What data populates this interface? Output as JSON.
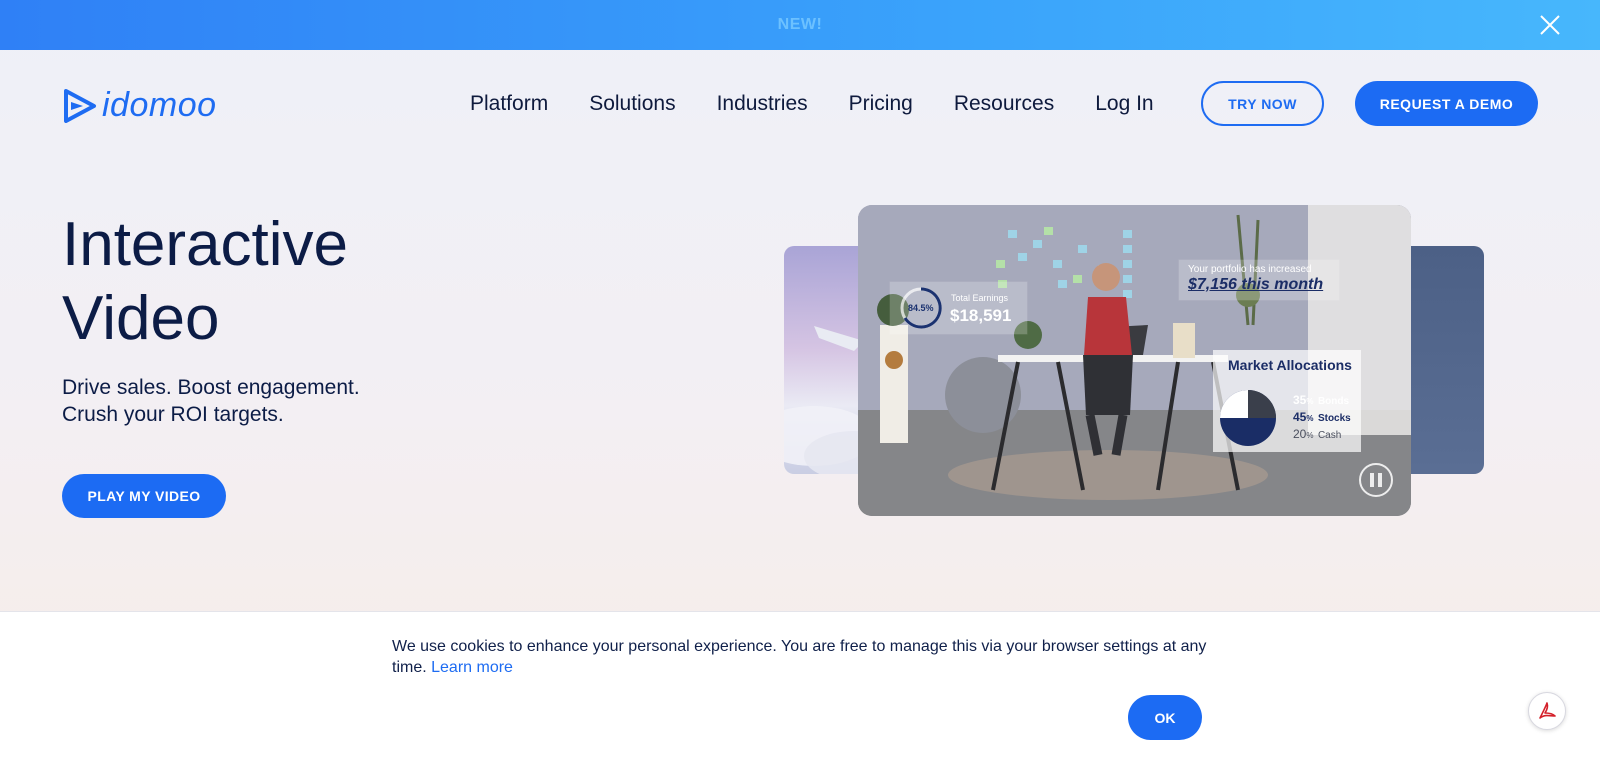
{
  "banner": {
    "text": "NEW!"
  },
  "logo": {
    "text": "idomoo"
  },
  "nav": {
    "items": [
      "Platform",
      "Solutions",
      "Industries",
      "Pricing",
      "Resources",
      "Log In"
    ],
    "try_label": "TRY NOW",
    "demo_label": "REQUEST A DEMO"
  },
  "hero": {
    "title_line1": "Interactive",
    "title_line2": "Video",
    "sub_line1": "Drive sales. Boost engagement.",
    "sub_line2": "Crush your ROI targets.",
    "play_label": "PLAY MY VIDEO"
  },
  "video": {
    "earnings_ring": "84.5%",
    "earnings_label": "Total Earnings",
    "earnings_value": "$18,591",
    "portfolio_label": "Your portfolio has increased",
    "portfolio_value": "$7,156 this month",
    "alloc_title": "Market Allocations",
    "alloc": [
      {
        "pct": "35",
        "unit": "%",
        "label": "Bonds"
      },
      {
        "pct": "45",
        "unit": "%",
        "label": "Stocks"
      },
      {
        "pct": "20",
        "unit": "%",
        "label": "Cash"
      }
    ]
  },
  "cookie": {
    "text": "We use cookies to enhance your personal experience. You are free to manage this via your browser settings at any time.",
    "link": "Learn more",
    "ok_label": "OK"
  },
  "colors": {
    "accent": "#1c6bf3",
    "navy": "#0c1c46",
    "banner": "#3aa3fb"
  }
}
